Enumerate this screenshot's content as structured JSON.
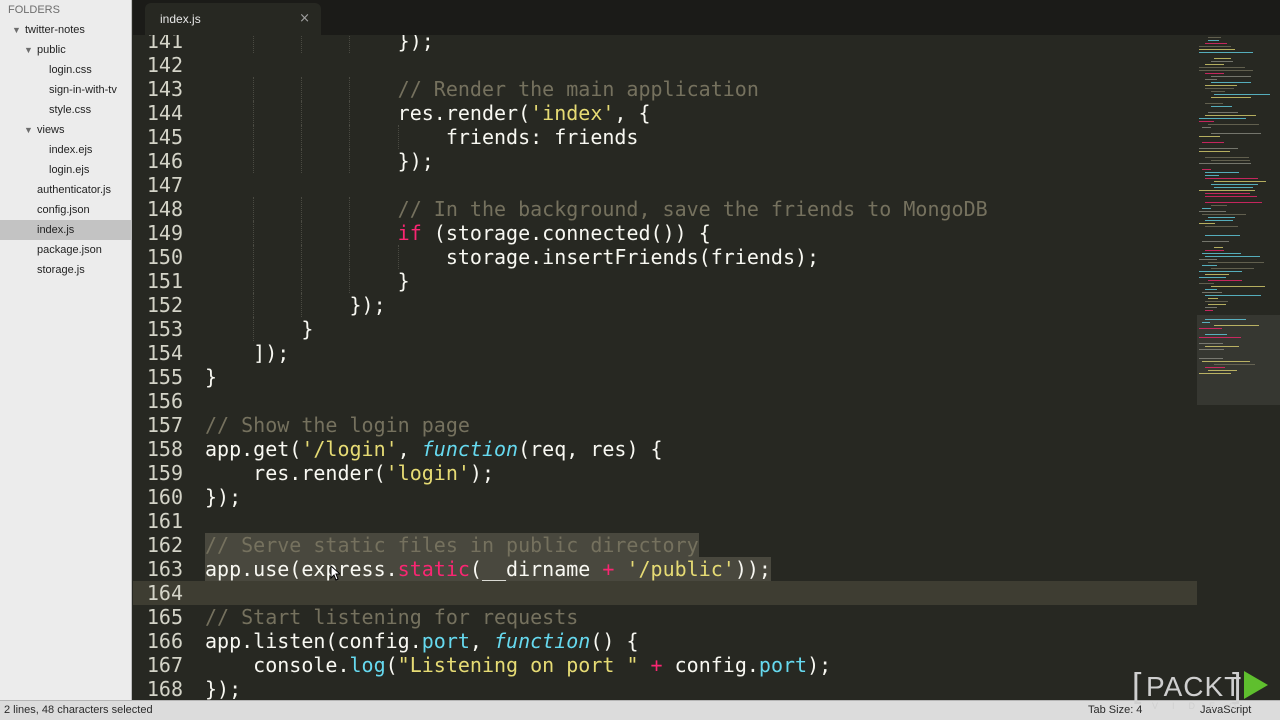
{
  "sidebar": {
    "header": "FOLDERS",
    "tree": [
      {
        "label": "twitter-notes",
        "kind": "folder",
        "expanded": true,
        "depth": 0
      },
      {
        "label": "public",
        "kind": "folder",
        "expanded": true,
        "depth": 1
      },
      {
        "label": "login.css",
        "kind": "file",
        "depth": 2
      },
      {
        "label": "sign-in-with-tv",
        "kind": "file",
        "depth": 2
      },
      {
        "label": "style.css",
        "kind": "file",
        "depth": 2
      },
      {
        "label": "views",
        "kind": "folder",
        "expanded": true,
        "depth": 1
      },
      {
        "label": "index.ejs",
        "kind": "file",
        "depth": 2
      },
      {
        "label": "login.ejs",
        "kind": "file",
        "depth": 2
      },
      {
        "label": "authenticator.js",
        "kind": "file",
        "depth": 1
      },
      {
        "label": "config.json",
        "kind": "file",
        "depth": 1
      },
      {
        "label": "index.js",
        "kind": "file",
        "depth": 1,
        "selected": true
      },
      {
        "label": "package.json",
        "kind": "file",
        "depth": 1
      },
      {
        "label": "storage.js",
        "kind": "file",
        "depth": 1
      }
    ]
  },
  "tab": {
    "title": "index.js",
    "close_symbol": "×"
  },
  "editor": {
    "current_line": 164,
    "lines": [
      {
        "n": 141,
        "tokens": [
          [
            "                });",
            ""
          ]
        ]
      },
      {
        "n": 142,
        "tokens": []
      },
      {
        "n": 143,
        "tokens": [
          [
            "                ",
            ""
          ],
          [
            "// Render the main application",
            "c"
          ]
        ]
      },
      {
        "n": 144,
        "tokens": [
          [
            "                res.render(",
            ""
          ],
          [
            "'index'",
            "s"
          ],
          [
            ", {",
            ""
          ]
        ]
      },
      {
        "n": 145,
        "tokens": [
          [
            "                    friends: friends",
            ""
          ]
        ]
      },
      {
        "n": 146,
        "tokens": [
          [
            "                });",
            ""
          ]
        ]
      },
      {
        "n": 147,
        "tokens": []
      },
      {
        "n": 148,
        "tokens": [
          [
            "                ",
            ""
          ],
          [
            "// In the background, save the friends to MongoDB",
            "c"
          ]
        ]
      },
      {
        "n": 149,
        "tokens": [
          [
            "                ",
            ""
          ],
          [
            "if",
            "k"
          ],
          [
            " (storage.connected()) {",
            ""
          ]
        ]
      },
      {
        "n": 150,
        "tokens": [
          [
            "                    storage.insertFriends(friends);",
            ""
          ]
        ]
      },
      {
        "n": 151,
        "tokens": [
          [
            "                }",
            ""
          ]
        ]
      },
      {
        "n": 152,
        "tokens": [
          [
            "            });",
            ""
          ]
        ]
      },
      {
        "n": 153,
        "tokens": [
          [
            "        }",
            ""
          ]
        ]
      },
      {
        "n": 154,
        "tokens": [
          [
            "    ]);",
            ""
          ]
        ]
      },
      {
        "n": 155,
        "tokens": [
          [
            "}",
            ""
          ]
        ]
      },
      {
        "n": 156,
        "tokens": []
      },
      {
        "n": 157,
        "tokens": [
          [
            "// Show the login page",
            "c"
          ]
        ]
      },
      {
        "n": 158,
        "tokens": [
          [
            "app.get(",
            ""
          ],
          [
            "'/login'",
            "s"
          ],
          [
            ", ",
            ""
          ],
          [
            "function",
            "f"
          ],
          [
            "(req, res) {",
            ""
          ]
        ]
      },
      {
        "n": 159,
        "tokens": [
          [
            "    res.render(",
            ""
          ],
          [
            "'login'",
            "s"
          ],
          [
            ");",
            ""
          ]
        ]
      },
      {
        "n": 160,
        "tokens": [
          [
            "});",
            ""
          ]
        ]
      },
      {
        "n": 161,
        "tokens": []
      },
      {
        "n": 162,
        "tokens": [
          [
            "// Serve static files in public directory",
            "c"
          ]
        ],
        "selected": true
      },
      {
        "n": 163,
        "tokens": [
          [
            "app.use(express.",
            ""
          ],
          [
            "static",
            "k"
          ],
          [
            "(__dirname ",
            ""
          ],
          [
            "+",
            "k"
          ],
          [
            " ",
            ""
          ],
          [
            "'/public'",
            "s"
          ],
          [
            "));",
            ""
          ]
        ],
        "selected": true
      },
      {
        "n": 164,
        "tokens": []
      },
      {
        "n": 165,
        "tokens": [
          [
            "// Start listening for requests",
            "c"
          ]
        ]
      },
      {
        "n": 166,
        "tokens": [
          [
            "app.listen(config.",
            ""
          ],
          [
            "port",
            "p"
          ],
          [
            ", ",
            ""
          ],
          [
            "function",
            "f"
          ],
          [
            "() {",
            ""
          ]
        ]
      },
      {
        "n": 167,
        "tokens": [
          [
            "    console.",
            ""
          ],
          [
            "log",
            "p"
          ],
          [
            "(",
            ""
          ],
          [
            "\"Listening on port \"",
            "s"
          ],
          [
            " ",
            ""
          ],
          [
            "+",
            "k"
          ],
          [
            " config.",
            ""
          ],
          [
            "port",
            "p"
          ],
          [
            ");",
            ""
          ]
        ]
      },
      {
        "n": 168,
        "tokens": [
          [
            "});",
            ""
          ]
        ]
      }
    ]
  },
  "status": {
    "selection": "2 lines, 48 characters selected",
    "tab_size": "Tab Size: 4",
    "syntax": "JavaScript"
  },
  "watermark": {
    "word": "PACKT",
    "sub": "VIDEO"
  },
  "colors": {
    "background": "#272822",
    "comment": "#75715e",
    "string": "#e6db74",
    "keyword": "#f92672",
    "storage": "#66d9ef",
    "selection": "#49483e",
    "current_line": "#3e3d32",
    "accent_green": "#5fbf2e"
  }
}
